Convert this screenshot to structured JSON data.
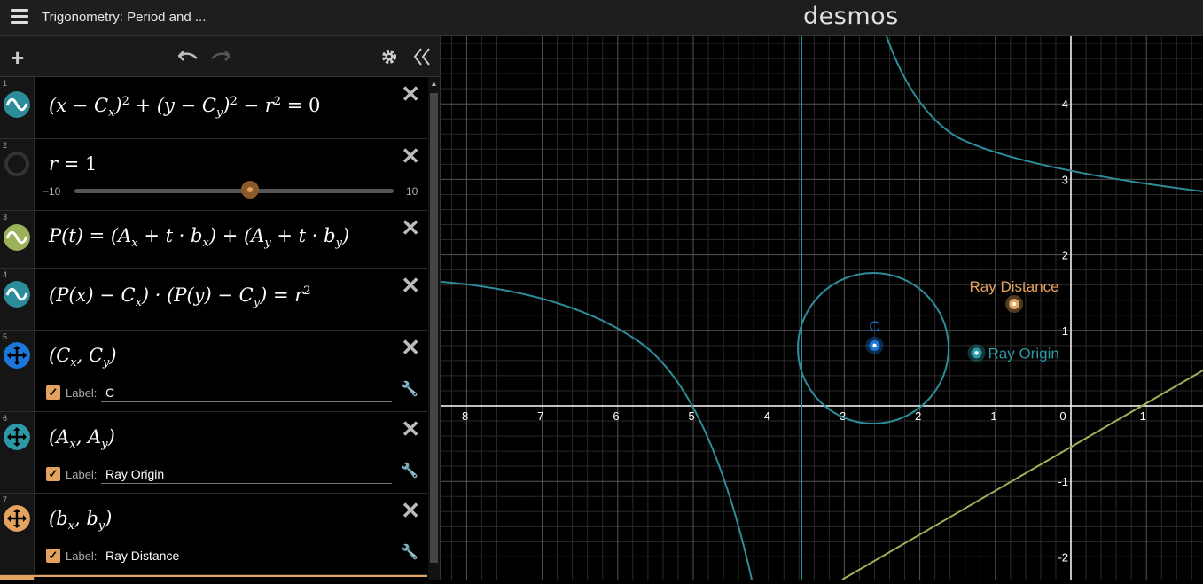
{
  "app": {
    "title": "Trigonometry: Period and ...",
    "logo": "desmos"
  },
  "toolbar": {
    "add_icon": "plus-icon",
    "undo_icon": "undo-icon",
    "redo_icon": "redo-icon",
    "settings_icon": "gear-icon",
    "collapse_icon": "double-chevron-left-icon"
  },
  "expressions": [
    {
      "index": "1",
      "icon": "wave-icon",
      "color": "#2d8c99"
    },
    {
      "index": "2",
      "icon": "hidden-circle-icon",
      "slider_min": "−10",
      "slider_max": "10",
      "slider_value_fraction": 0.55
    },
    {
      "index": "3",
      "icon": "wave-icon",
      "color": "#9bb25a"
    },
    {
      "index": "4",
      "icon": "wave-icon",
      "color": "#2d8c99"
    },
    {
      "index": "5",
      "icon": "move-arrows-icon",
      "color": "#1c77d8",
      "label_caption": "Label:",
      "label_value": "C"
    },
    {
      "index": "6",
      "icon": "move-arrows-icon",
      "color": "#2d99a6",
      "label_caption": "Label:",
      "label_value": "Ray Origin"
    },
    {
      "index": "7",
      "icon": "move-arrows-icon",
      "color": "#e3a35f",
      "label_caption": "Label:",
      "label_value": "Ray Distance"
    }
  ],
  "graph": {
    "x_ticks": [
      "-8",
      "-7",
      "-6",
      "-5",
      "-4",
      "-3",
      "-2",
      "-1",
      "0",
      "1"
    ],
    "y_ticks": [
      "4",
      "3",
      "2",
      "1",
      "-1",
      "-2"
    ],
    "points": [
      {
        "label": "C",
        "x": -2.6,
        "y": 0.8,
        "color": "#1c77d8"
      },
      {
        "label": "Ray Origin",
        "x": -1.25,
        "y": 0.7,
        "color": "#2d99a6"
      },
      {
        "label": "Ray Distance",
        "x": -0.75,
        "y": 1.35,
        "color": "#e3a35f"
      }
    ],
    "colors": {
      "teal": "#2d8c99",
      "olive": "#9bb25a",
      "blue": "#1c77d8",
      "orange": "#e3a35f"
    }
  }
}
